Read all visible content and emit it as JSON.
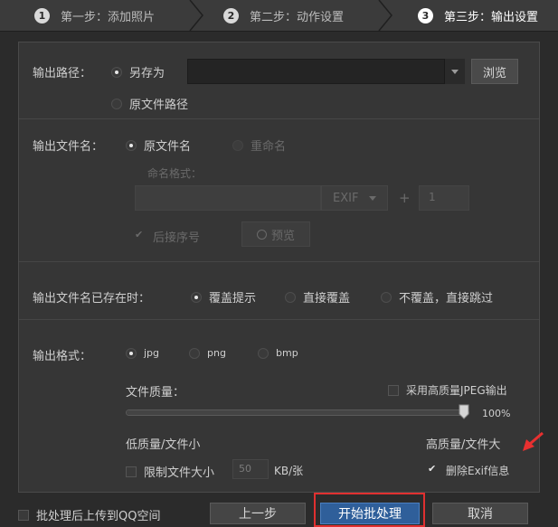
{
  "steps": [
    {
      "num": "1",
      "label": "第一步：添加照片",
      "active": false
    },
    {
      "num": "2",
      "label": "第二步：动作设置",
      "active": false
    },
    {
      "num": "3",
      "label": "第三步：输出设置",
      "active": true
    }
  ],
  "output_path": {
    "label": "输出路径：",
    "save_as": "另存为",
    "original_path": "原文件路径",
    "path_value": "",
    "browse_button": "浏览"
  },
  "output_filename": {
    "label": "输出文件名：",
    "original_name": "原文件名",
    "rename": "重命名",
    "naming_format_label": "命名格式：",
    "format_value": "",
    "exif_button": "EXIF",
    "plus_symbol": "+",
    "sequence_value": "1",
    "sort_by_label": "后接序号",
    "preview_button": "预览"
  },
  "exists": {
    "label": "输出文件名已存在时：",
    "prompt_overwrite": "覆盖提示",
    "direct_overwrite": "直接覆盖",
    "skip": "不覆盖，直接跳过"
  },
  "format": {
    "label": "输出格式：",
    "options": [
      "jpg",
      "png",
      "bmp"
    ],
    "selected": "jpg",
    "quality_label": "文件质量：",
    "hq_jpeg_label": "采用高质量JPEG输出",
    "quality_value": "100%",
    "quality_fraction": 1.0,
    "low_label": "低质量/文件小",
    "high_label": "高质量/文件大",
    "limit_size_label": "限制文件大小",
    "limit_size_value": "50",
    "limit_size_unit": "KB/张",
    "remove_exif_label": "删除Exif信息"
  },
  "bottom": {
    "upload_label": "批处理后上传到QQ空间",
    "prev_button": "上一步",
    "start_button": "开始批处理",
    "cancel_button": "取消"
  },
  "colors": {
    "accent": "#2f5f9a",
    "highlight": "#e03030"
  }
}
